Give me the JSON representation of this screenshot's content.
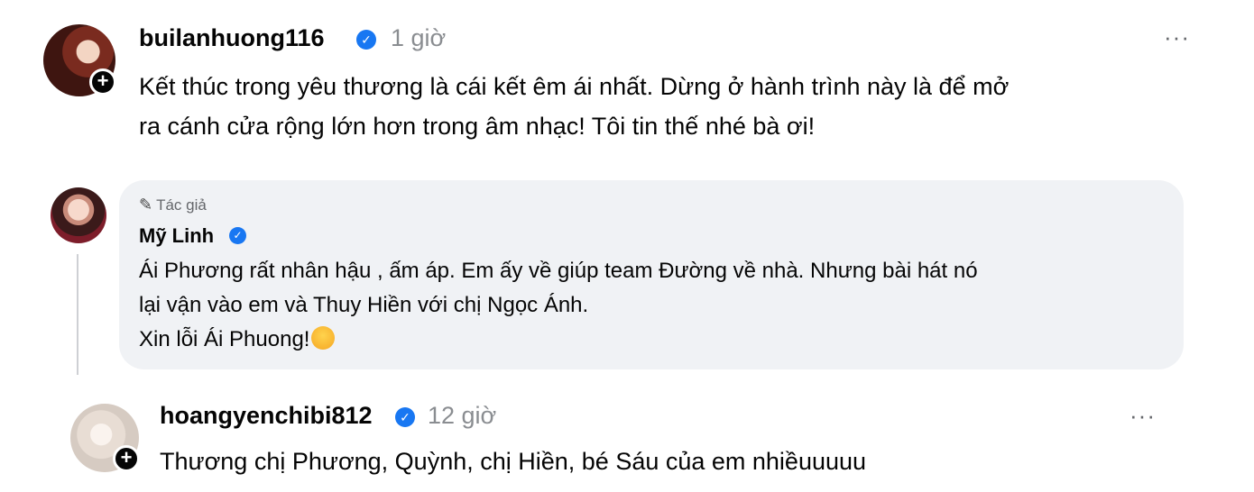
{
  "post1": {
    "username": "builanhuong116",
    "time": "1 giờ",
    "more": "···",
    "lines": [
      "Kết thúc trong yêu thương là cái kết êm ái nhất. Dừng ở hành trình này là để mở",
      "ra cánh cửa rộng lớn hơn trong âm nhạc! Tôi tin thế nhé bà ơi!"
    ]
  },
  "reply": {
    "author_tag": "Tác giả",
    "name": "Mỹ Linh",
    "lines": [
      "Ái Phương rất nhân hậu , ấm áp. Em ấy về giúp team Đường về nhà. Nhưng bài hát nó",
      "lại vận vào em và Thuy Hiền với chị Ngọc Ánh.",
      "Xin lỗi Ái Phuong!"
    ]
  },
  "post2": {
    "username": "hoangyenchibi812",
    "time": "12 giờ",
    "more": "···",
    "text": "Thương chị Phương, Quỳnh, chị Hiền, bé Sáu của em nhiềuuuuu"
  },
  "icons": {
    "verified": "verified-badge-icon",
    "plus": "follow-plus-icon",
    "pen": "pen-icon",
    "emoji": "sad-crying-emoji-icon"
  },
  "colors": {
    "verified": "#1877f2",
    "bubble": "#f0f2f5",
    "muted": "#8a8d91"
  }
}
